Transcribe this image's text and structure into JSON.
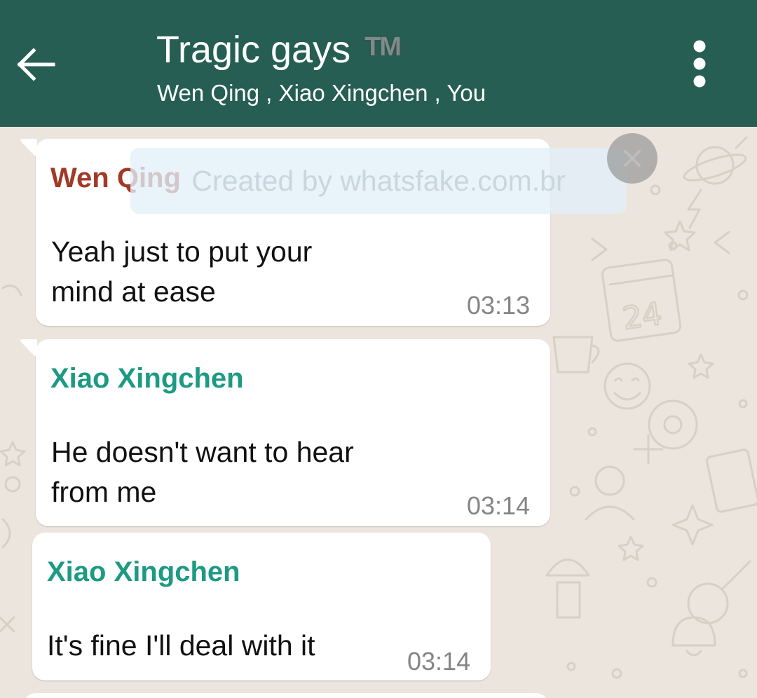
{
  "header": {
    "title": "Tragic gays",
    "title_mark": "TM",
    "participants": "Wen Qing , Xiao Xingchen , You",
    "back_icon": "arrow-left-icon",
    "menu_icon": "more-vertical-icon"
  },
  "watermark": {
    "text": "Created by whatsfake.com.br",
    "close_icon": "close-icon"
  },
  "messages": [
    {
      "sender": "Wen Qing",
      "sender_color": "#a13a26",
      "line1": "Yeah just to put your",
      "line2": "mind at ease",
      "time": "03:13"
    },
    {
      "sender": "Xiao Xingchen",
      "sender_color": "#1d9a83",
      "line1": "He doesn't want to hear",
      "line2": "from me",
      "time": "03:14"
    },
    {
      "sender": "Xiao Xingchen",
      "sender_color": "#1d9a83",
      "line1": "It's fine I'll deal with it",
      "time": "03:14"
    }
  ],
  "colors": {
    "header_bg": "#265e53",
    "chat_bg": "#ece5dd",
    "bubble_bg": "#ffffff",
    "timestamp": "#858585"
  }
}
